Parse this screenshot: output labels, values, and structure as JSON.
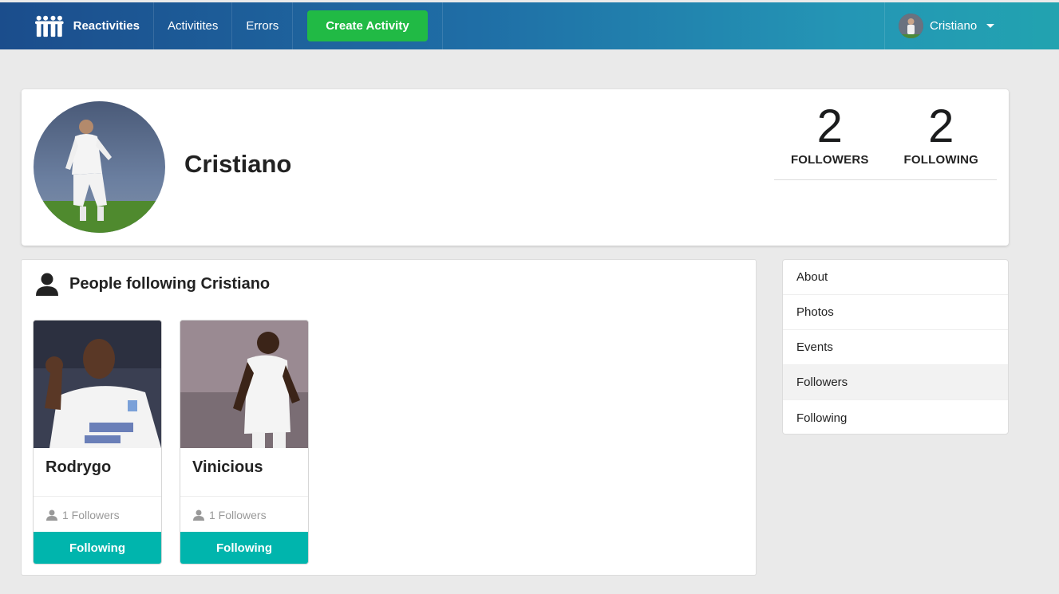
{
  "nav": {
    "brand": "Reactivities",
    "items": [
      "Activitites",
      "Errors"
    ],
    "create_button": "Create Activity",
    "user_name": "Cristiano"
  },
  "profile": {
    "name": "Cristiano",
    "followers_count": "2",
    "followers_label": "FOLLOWERS",
    "following_count": "2",
    "following_label": "FOLLOWING"
  },
  "panel": {
    "title": "People following Cristiano",
    "cards": [
      {
        "name": "Rodrygo",
        "followers": "1 Followers",
        "button": "Following"
      },
      {
        "name": "Vinicious",
        "followers": "1 Followers",
        "button": "Following"
      }
    ]
  },
  "menu": {
    "items": [
      "About",
      "Photos",
      "Events",
      "Followers",
      "Following"
    ],
    "active": "Followers"
  },
  "colors": {
    "create_button": "#21ba45",
    "follow_button": "#00b5ad"
  }
}
